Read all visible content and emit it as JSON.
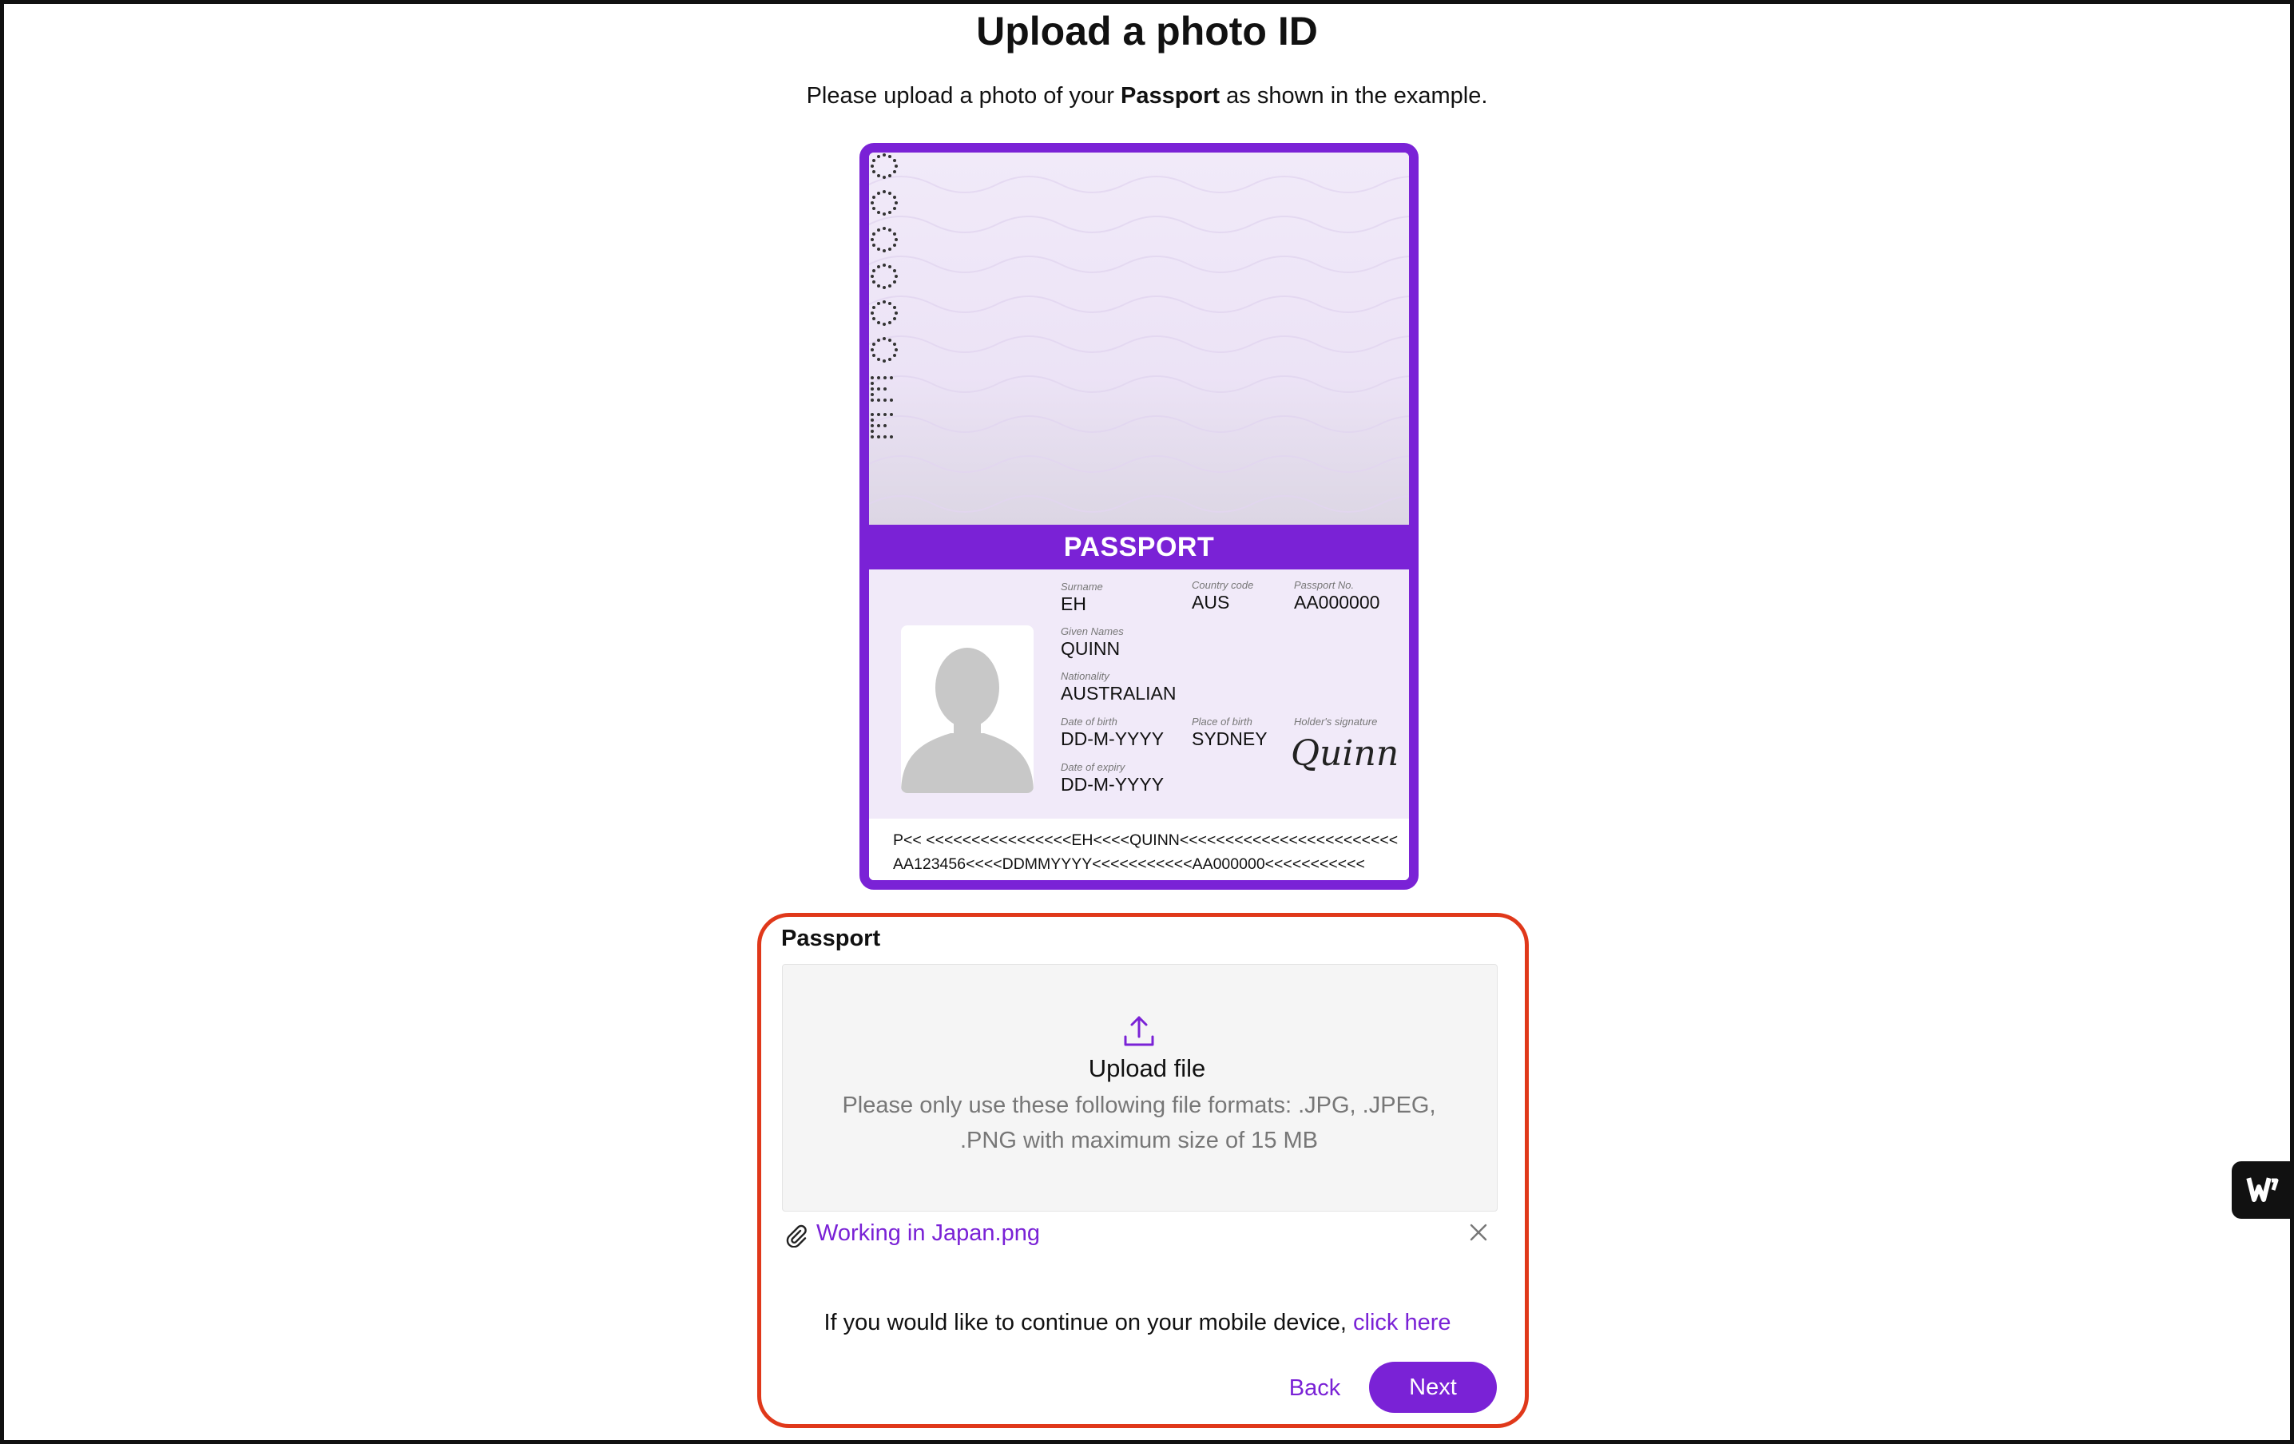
{
  "page": {
    "title": "Upload a photo ID",
    "subtitle_before": "Please upload a photo of your ",
    "subtitle_bold": "Passport",
    "subtitle_after": " as shown in the example."
  },
  "passport_example": {
    "band_label": "PASSPORT",
    "fields": {
      "surname_label": "Surname",
      "surname": "EH",
      "country_code_label": "Country code",
      "country_code": "AUS",
      "passport_no_label": "Passport No.",
      "passport_no": "AA000000",
      "given_names_label": "Given Names",
      "given_names": "QUINN",
      "nationality_label": "Nationality",
      "nationality": "AUSTRALIAN",
      "dob_label": "Date of birth",
      "dob": "DD-M-YYYY",
      "pob_label": "Place of birth",
      "pob": "SYDNEY",
      "signature_label": "Holder's signature",
      "signature": "Quinn",
      "expiry_label": "Date of expiry",
      "expiry": "DD-M-YYYY"
    },
    "mrz_line1": "P<< <<<<<<<<<<<<<<<<EH<<<<QUINN<<<<<<<<<<<<<<<<<<<<<<<<",
    "mrz_line2": "AA123456<<<<DDMMYYYY<<<<<<<<<<<AA000000<<<<<<<<<<<"
  },
  "upload": {
    "section_label": "Passport",
    "dropzone_title": "Upload file",
    "dropzone_hint": "Please only use these following file formats: .JPG, .JPEG, .PNG with maximum size of 15 MB",
    "attached_file": "Working in Japan.png"
  },
  "mobile": {
    "text": "If you would like to continue on your mobile device, ",
    "link": "click here"
  },
  "actions": {
    "back": "Back",
    "next": "Next"
  },
  "icons": {
    "upload": "upload-icon",
    "attachment": "paperclip-icon",
    "remove": "close-icon",
    "widget": "w-logo-icon"
  },
  "colors": {
    "accent": "#7a22d6",
    "highlight_border": "#e0381a"
  }
}
